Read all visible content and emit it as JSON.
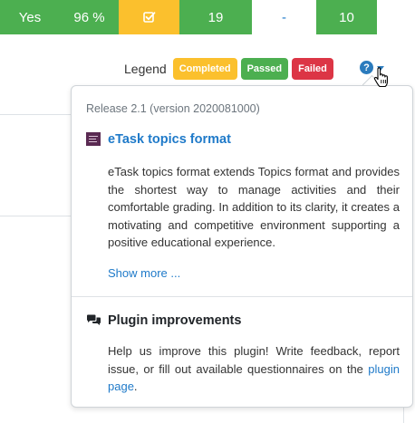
{
  "grade_row": {
    "cells": [
      "Yes",
      "96 %",
      "19",
      "-",
      "10"
    ],
    "checkbox_icon": "check-square-icon"
  },
  "legend": {
    "label": "Legend",
    "badges": [
      "Completed",
      "Passed",
      "Failed"
    ],
    "help_icon": "question-circle-icon",
    "caret_icon": "caret-down-icon"
  },
  "popover": {
    "release": "Release 2.1 (version 2020081000)",
    "plugin_title": "eTask topics format",
    "description": "eTask topics format extends Topics format and provides the shortest way to manage activities and their comfortable grading. In addition to its clarity, it creates a motivating and competitive environment supporting a positive educational experience.",
    "show_more": "Show more ...",
    "improvements_title": "Plugin improvements",
    "improvements_text": "Help us improve this plugin! Write feedback, report issue, or fill out available questionnaires on the",
    "improvements_link": "plugin page",
    "improvements_end": "."
  },
  "colors": {
    "green": "#4caf50",
    "amber": "#fbc02d",
    "red": "#dc3545",
    "link": "#1f7ac9"
  }
}
